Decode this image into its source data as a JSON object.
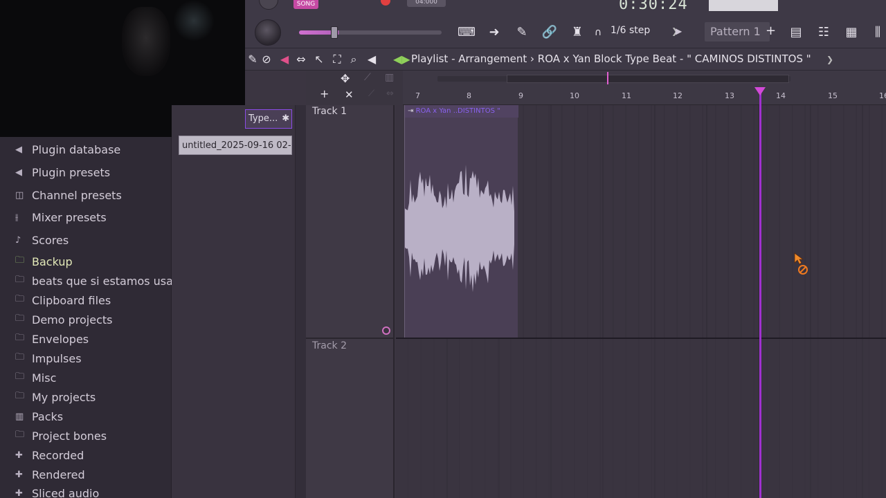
{
  "toolbar": {
    "song_label": "SONG",
    "tempo_label": "04:000",
    "time_display": "0:30:24",
    "snap_value": "1/6 step",
    "pattern_name": "Pattern 1",
    "pattern_add": "+"
  },
  "playlist": {
    "title": "Playlist - Arrangement  ›  ROA x Yan Block Type Beat -  \" CAMINOS DISTINTOS \"",
    "ruler_bars": [
      "7",
      "8",
      "9",
      "10",
      "11",
      "12",
      "13",
      "14",
      "15",
      "16"
    ],
    "tracks": [
      {
        "name": "Track 1"
      },
      {
        "name": "Track 2"
      }
    ],
    "clip_label": "ROA x Yan ..DISTINTOS \""
  },
  "picker": {
    "tab_label": "Type...",
    "clip_name": "untitled_2025-09-16 02-..."
  },
  "browser": {
    "items": [
      {
        "label": "Plugin database",
        "icon": "plug-icon"
      },
      {
        "label": "Plugin presets",
        "icon": "plug-icon"
      },
      {
        "label": "Channel presets",
        "icon": "channel-icon"
      },
      {
        "label": "Mixer presets",
        "icon": "mixer-icon"
      },
      {
        "label": "Scores",
        "icon": "note-icon"
      },
      {
        "label": "Backup",
        "icon": "folder-backup-icon"
      },
      {
        "label": "beats que si estamos usando",
        "icon": "folder-icon"
      },
      {
        "label": "Clipboard files",
        "icon": "folder-icon"
      },
      {
        "label": "Demo projects",
        "icon": "folder-icon"
      },
      {
        "label": "Envelopes",
        "icon": "folder-icon"
      },
      {
        "label": "Impulses",
        "icon": "folder-icon"
      },
      {
        "label": "Misc",
        "icon": "folder-icon"
      },
      {
        "label": "My projects",
        "icon": "folder-icon"
      },
      {
        "label": "Packs",
        "icon": "packs-icon"
      },
      {
        "label": "Project bones",
        "icon": "folder-icon"
      },
      {
        "label": "Recorded",
        "icon": "recorded-icon"
      },
      {
        "label": "Rendered",
        "icon": "rendered-icon"
      },
      {
        "label": "Sliced audio",
        "icon": "sliced-icon"
      }
    ]
  },
  "colors": {
    "accent": "#a030d0",
    "waveform": "#b9b0c6",
    "clip_label": "#8a62f0"
  }
}
